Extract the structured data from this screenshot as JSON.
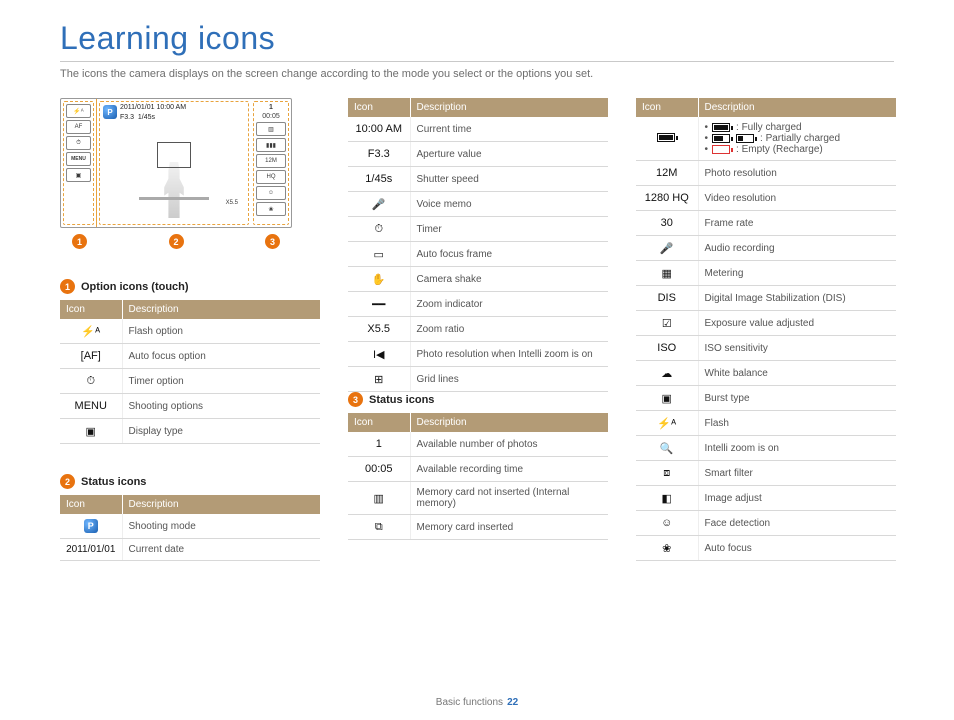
{
  "page": {
    "title": "Learning icons",
    "intro": "The icons the camera displays on the screen change according to the mode you select or the options you set.",
    "footer_section": "Basic functions",
    "footer_page": "22"
  },
  "diagram": {
    "datetime": "2011/01/01 10:00 AM",
    "fnumber": "F3.3",
    "shutter": "1/45s",
    "count": "1",
    "rec": "00:05",
    "zoom": "X5.5",
    "menu_label": "MENU"
  },
  "headers": {
    "icon": "Icon",
    "desc": "Description"
  },
  "sections": {
    "s1": {
      "num": "1",
      "title": "Option icons (touch)"
    },
    "s2": {
      "num": "2",
      "title": "Status icons"
    },
    "s3": {
      "num": "3",
      "title": "Status icons"
    }
  },
  "table1": [
    {
      "icon": "⚡ᴬ",
      "desc": "Flash option"
    },
    {
      "icon": "[AF]",
      "desc": "Auto focus option"
    },
    {
      "icon": "⏱",
      "desc": "Timer option"
    },
    {
      "icon": "MENU",
      "desc": "Shooting options"
    },
    {
      "icon": "▣",
      "desc": "Display type"
    }
  ],
  "table2a": [
    {
      "icon": "Ⓟ",
      "desc": "Shooting mode"
    },
    {
      "icon": "2011/01/01",
      "desc": "Current date"
    }
  ],
  "table2b": [
    {
      "icon": "10:00 AM",
      "desc": "Current time"
    },
    {
      "icon": "F3.3",
      "desc": "Aperture value"
    },
    {
      "icon": "1/45s",
      "desc": "Shutter speed"
    },
    {
      "icon": "🎤",
      "desc": "Voice memo"
    },
    {
      "icon": "⏱",
      "desc": "Timer"
    },
    {
      "icon": "▭",
      "desc": "Auto focus frame"
    },
    {
      "icon": "✋",
      "desc": "Camera shake"
    },
    {
      "icon": "━━",
      "desc": "Zoom indicator"
    },
    {
      "icon": "X5.5",
      "desc": "Zoom ratio"
    },
    {
      "icon": "I◀",
      "desc": "Photo resolution when Intelli zoom is on"
    },
    {
      "icon": "⊞",
      "desc": "Grid lines"
    }
  ],
  "table3": [
    {
      "icon": "1",
      "desc": "Available number of photos"
    },
    {
      "icon": "00:05",
      "desc": "Available recording time"
    },
    {
      "icon": "▥",
      "desc": "Memory card not inserted (Internal memory)"
    },
    {
      "icon": "⧉",
      "desc": "Memory card inserted"
    }
  ],
  "table3b_header_desc": "Description",
  "battery": {
    "full": ": Fully charged",
    "partial": ": Partially charged",
    "empty": ": Empty (Recharge)"
  },
  "table3b": [
    {
      "icon": "12M",
      "desc": "Photo resolution"
    },
    {
      "icon": "1280 HQ",
      "desc": "Video resolution"
    },
    {
      "icon": "30",
      "desc": "Frame rate"
    },
    {
      "icon": "🎤",
      "desc": "Audio recording"
    },
    {
      "icon": "▦",
      "desc": "Metering"
    },
    {
      "icon": "DIS",
      "desc": "Digital Image Stabilization (DIS)"
    },
    {
      "icon": "☑",
      "desc": "Exposure value adjusted"
    },
    {
      "icon": "ISO",
      "desc": "ISO sensitivity"
    },
    {
      "icon": "☁",
      "desc": "White balance"
    },
    {
      "icon": "▣",
      "desc": "Burst type"
    },
    {
      "icon": "⚡ᴬ",
      "desc": "Flash"
    },
    {
      "icon": "🔍",
      "desc": "Intelli zoom is on"
    },
    {
      "icon": "⧈",
      "desc": "Smart filter"
    },
    {
      "icon": "◧",
      "desc": "Image adjust"
    },
    {
      "icon": "☺",
      "desc": "Face detection"
    },
    {
      "icon": "❀",
      "desc": "Auto focus"
    }
  ]
}
